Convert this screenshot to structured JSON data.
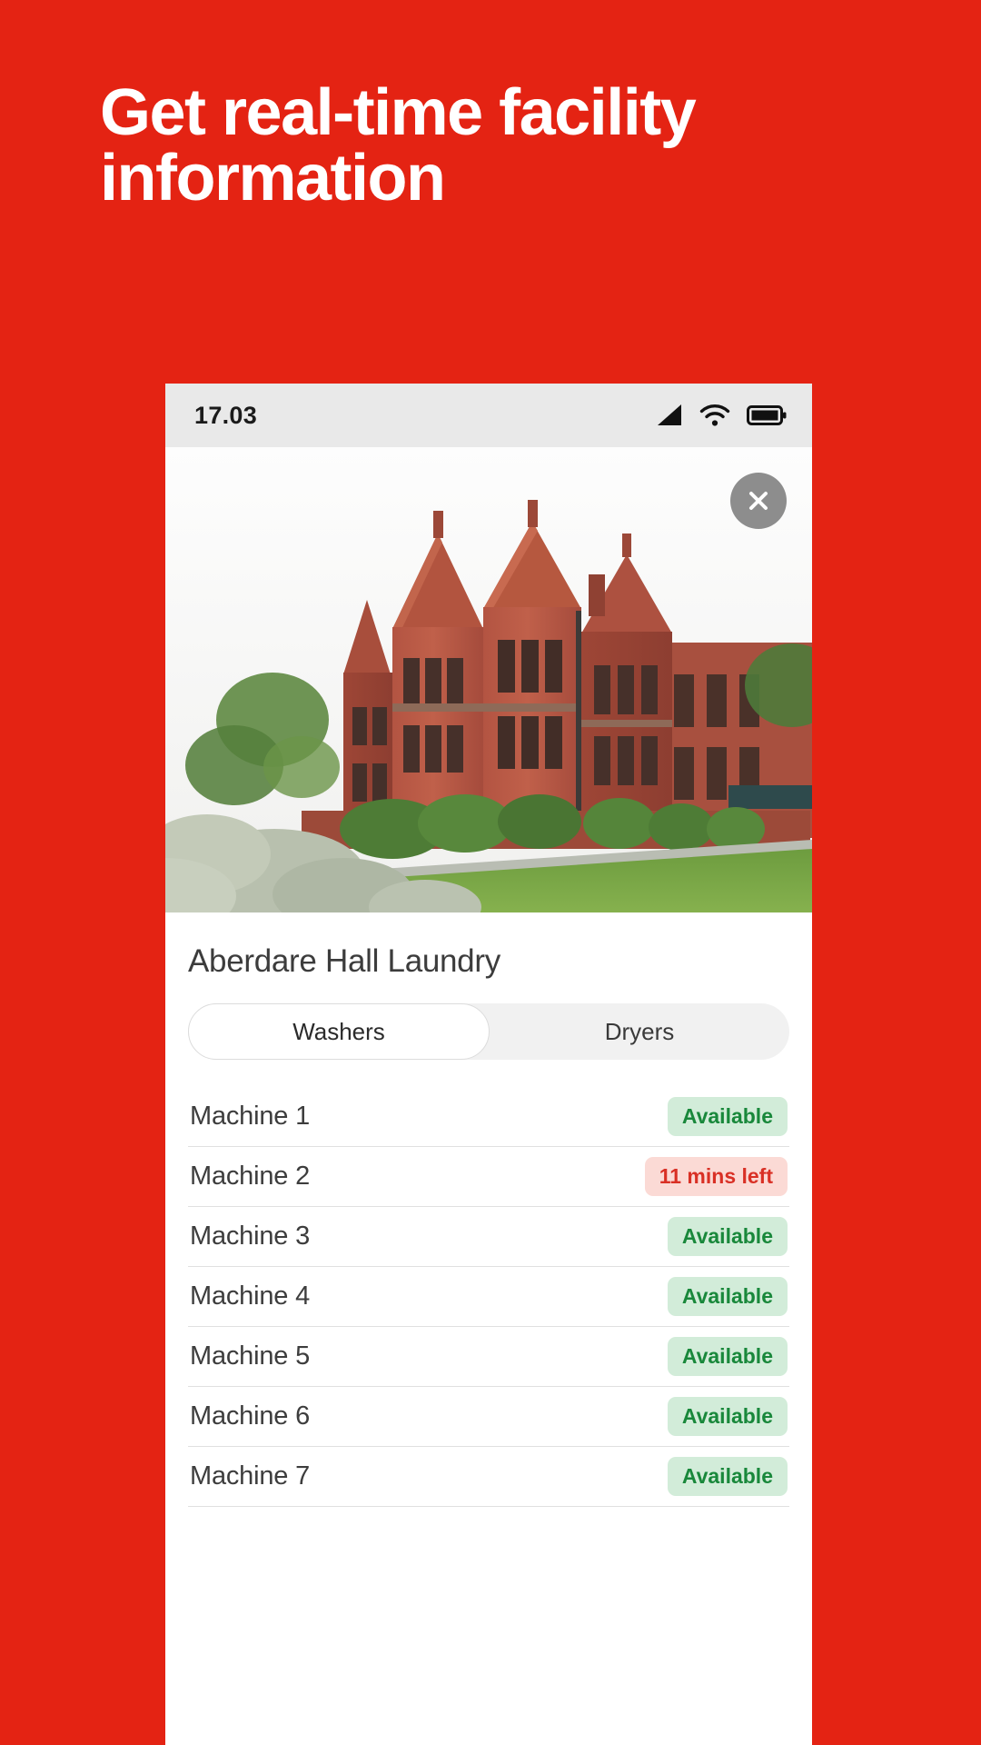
{
  "promo": {
    "headline": "Get real-time facility information",
    "background_color": "#e42313",
    "headline_color": "#ffffff"
  },
  "phone": {
    "status_bar": {
      "time": "17.03",
      "icons": [
        "signal-icon",
        "wifi-icon",
        "battery-icon"
      ],
      "background_color": "#e9e9e9"
    },
    "hero": {
      "alt": "Aberdare Hall red brick Victorian building with lawn and hedges",
      "close_button": "close-icon"
    },
    "facility_title": "Aberdare Hall Laundry",
    "tabs": [
      {
        "label": "Washers",
        "active": true
      },
      {
        "label": "Dryers",
        "active": false
      }
    ],
    "machines": [
      {
        "name": "Machine 1",
        "status": "Available",
        "state": "available"
      },
      {
        "name": "Machine 2",
        "status": "11 mins left",
        "state": "busy"
      },
      {
        "name": "Machine 3",
        "status": "Available",
        "state": "available"
      },
      {
        "name": "Machine 4",
        "status": "Available",
        "state": "available"
      },
      {
        "name": "Machine 5",
        "status": "Available",
        "state": "available"
      },
      {
        "name": "Machine 6",
        "status": "Available",
        "state": "available"
      },
      {
        "name": "Machine 7",
        "status": "Available",
        "state": "available"
      }
    ],
    "colors": {
      "available_bg": "#d2ecd9",
      "available_text": "#19883b",
      "busy_bg": "#fbdad5",
      "busy_text": "#d93025"
    }
  }
}
